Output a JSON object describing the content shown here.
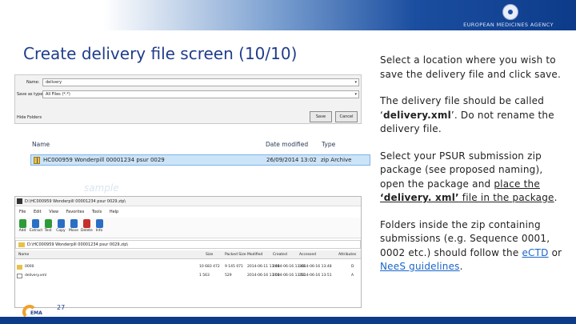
{
  "header": {
    "agency": "EUROPEAN MEDICINES AGENCY"
  },
  "slide": {
    "title": "Create delivery file screen (10/10)",
    "page_number": "27",
    "logo_text": "EMA"
  },
  "instructions": {
    "p1": "Select a location where you wish to save the delivery file and click save.",
    "p2_pre": "The delivery file should be called ‘",
    "p2_bold": "delivery.xml",
    "p2_post": "’. Do not rename the delivery file.",
    "p3_pre": "Select your PSUR submission zip package (see proposed naming), open the package and ",
    "p3_u1": "place the ",
    "p3_u2": "‘delivery. xml’",
    "p3_u3": " file in the package",
    "p3_end": ".",
    "p4_pre": "Folders inside the zip containing submissions (e.g. Sequence 0001, 0002 etc.) should follow the ",
    "link_ectd": "eCTD",
    "p4_mid": " or ",
    "link_nees": "NeeS guidelines",
    "p4_end": "."
  },
  "save_dialog": {
    "name_label": "Name:",
    "name_value": "delivery",
    "type_label": "Save as type:",
    "type_value": "All Files (*.*)",
    "browse_label": "Hide Folders",
    "save_button": "Save",
    "cancel_button": "Cancel"
  },
  "file_list": {
    "col_name": "Name",
    "col_date": "Date modified",
    "col_type": "Type",
    "row": {
      "name": "HC000959 Wonderpill 00001234 psur 0029",
      "date": "26/09/2014 13:02",
      "type": "zip Archive"
    },
    "watermark": "sample"
  },
  "archive_window": {
    "title": "D:\\HC000959 Wonderpill 00001234 psur 0029.zip\\",
    "menu": [
      "File",
      "Edit",
      "View",
      "Favorites",
      "Tools",
      "Help"
    ],
    "tools": [
      {
        "label": "Add",
        "color": "#2e9a3a"
      },
      {
        "label": "Extract",
        "color": "#2b6fc4"
      },
      {
        "label": "Test",
        "color": "#2e9a3a"
      },
      {
        "label": "Copy",
        "color": "#2b6fc4"
      },
      {
        "label": "Move",
        "color": "#2b6fc4"
      },
      {
        "label": "Delete",
        "color": "#c4302b"
      },
      {
        "label": "Info",
        "color": "#2b6fc4"
      }
    ],
    "path": "D:\\HC000959 Wonderpill 00001234 psur 0029.zip\\",
    "headers": [
      "Name",
      "Size",
      "Packed Size",
      "Modified",
      "Created",
      "Accessed",
      "Attributes"
    ],
    "rows": [
      {
        "name": "0000",
        "size": "10 683 472",
        "packed": "9 145 071",
        "modified": "2014-06-11 13:48",
        "created": "2014-06-16 13:48",
        "accessed": "2014-06-16 13:48",
        "attr": "D"
      },
      {
        "name": "delivery.xml",
        "size": "1 563",
        "packed": "529",
        "modified": "2014-06-16 13:50",
        "created": "2014-06-16 13:50",
        "accessed": "2014-06-16 13:51",
        "attr": "A"
      }
    ]
  },
  "colors": {
    "title_blue": "#1f3d8a",
    "link_blue": "#1a66c9",
    "selection": "#cce4f7"
  }
}
